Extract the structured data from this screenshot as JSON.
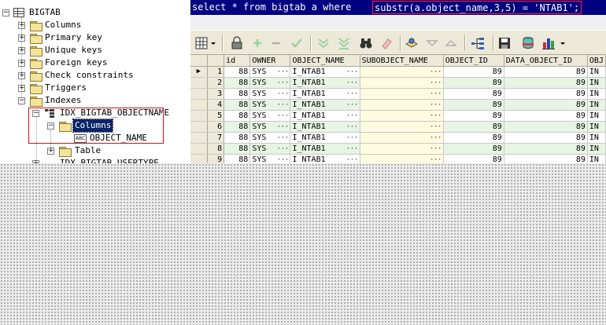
{
  "tree": {
    "root": "BIGTAB",
    "children": [
      "Columns",
      "Primary key",
      "Unique keys",
      "Foreign keys",
      "Check constraints",
      "Triggers",
      "Indexes"
    ],
    "index_name": "IDX_BIGTAB_OBJECTNAME",
    "index_columns_label": "Columns",
    "index_column": "OBJECT_NAME",
    "index_table_label": "Table",
    "next_index_partial": "IDX_BIGTAB_USERTYPE"
  },
  "sql": {
    "prefix": "select * from bigtab a where ",
    "highlight": "substr(a.object_name,3,5) = 'NTAB1';"
  },
  "toolbar": {
    "buttons": [
      "grid-view-icon",
      "lock-icon",
      "plus-icon",
      "minus-icon",
      "check-icon",
      "move-down-icon",
      "move-bottom-icon",
      "binoculars-icon",
      "eraser-icon",
      "export-icon",
      "arrow-down-icon",
      "arrow-up-icon",
      "tree-icon",
      "save-icon",
      "database-icon",
      "chart-icon"
    ]
  },
  "grid": {
    "columns": [
      "id",
      "OWNER",
      "OBJECT_NAME",
      "SUBOBJECT_NAME",
      "OBJECT_ID",
      "DATA_OBJECT_ID",
      "OBJ"
    ],
    "ellipsis": "···",
    "rows": [
      {
        "n": "1",
        "id": "88",
        "owner": "SYS",
        "name": "I_NTAB1",
        "oid": "89",
        "doid": "89",
        "obj": "IN"
      },
      {
        "n": "2",
        "id": "88",
        "owner": "SYS",
        "name": "I_NTAB1",
        "oid": "89",
        "doid": "89",
        "obj": "IN"
      },
      {
        "n": "3",
        "id": "88",
        "owner": "SYS",
        "name": "I_NTAB1",
        "oid": "89",
        "doid": "89",
        "obj": "IN"
      },
      {
        "n": "4",
        "id": "88",
        "owner": "SYS",
        "name": "I_NTAB1",
        "oid": "89",
        "doid": "89",
        "obj": "IN"
      },
      {
        "n": "5",
        "id": "88",
        "owner": "SYS",
        "name": "I_NTAB1",
        "oid": "89",
        "doid": "89",
        "obj": "IN"
      },
      {
        "n": "6",
        "id": "88",
        "owner": "SYS",
        "name": "I_NTAB1",
        "oid": "89",
        "doid": "89",
        "obj": "IN"
      },
      {
        "n": "7",
        "id": "88",
        "owner": "SYS",
        "name": "I_NTAB1",
        "oid": "89",
        "doid": "89",
        "obj": "IN"
      },
      {
        "n": "8",
        "id": "88",
        "owner": "SYS",
        "name": "I_NTAB1",
        "oid": "89",
        "doid": "89",
        "obj": "IN"
      },
      {
        "n": "9",
        "id": "88",
        "owner": "SYS",
        "name": "I_NTAB1",
        "oid": "89",
        "doid": "89",
        "obj": "IN"
      }
    ]
  }
}
